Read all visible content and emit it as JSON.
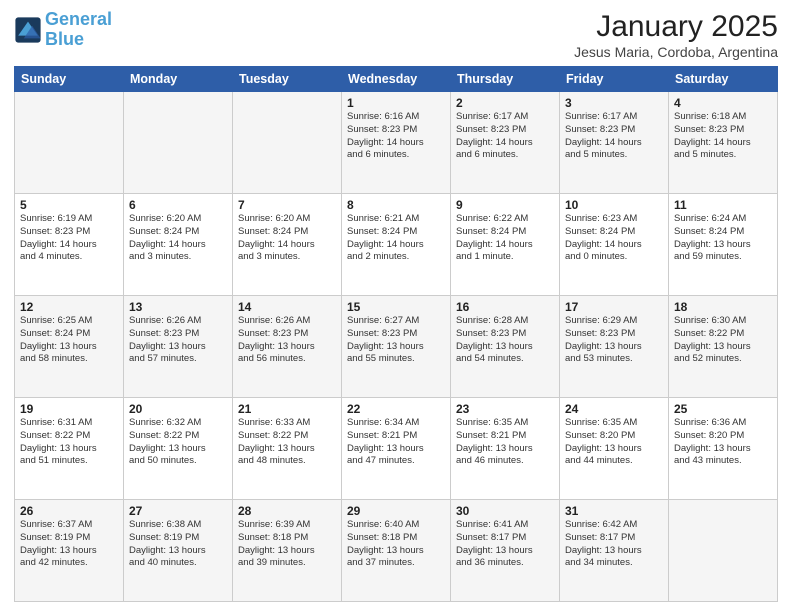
{
  "header": {
    "logo_line1": "General",
    "logo_line2": "Blue",
    "main_title": "January 2025",
    "subtitle": "Jesus Maria, Cordoba, Argentina"
  },
  "days_of_week": [
    "Sunday",
    "Monday",
    "Tuesday",
    "Wednesday",
    "Thursday",
    "Friday",
    "Saturday"
  ],
  "weeks": [
    [
      {
        "day": "",
        "info": ""
      },
      {
        "day": "",
        "info": ""
      },
      {
        "day": "",
        "info": ""
      },
      {
        "day": "1",
        "info": "Sunrise: 6:16 AM\nSunset: 8:23 PM\nDaylight: 14 hours\nand 6 minutes."
      },
      {
        "day": "2",
        "info": "Sunrise: 6:17 AM\nSunset: 8:23 PM\nDaylight: 14 hours\nand 6 minutes."
      },
      {
        "day": "3",
        "info": "Sunrise: 6:17 AM\nSunset: 8:23 PM\nDaylight: 14 hours\nand 5 minutes."
      },
      {
        "day": "4",
        "info": "Sunrise: 6:18 AM\nSunset: 8:23 PM\nDaylight: 14 hours\nand 5 minutes."
      }
    ],
    [
      {
        "day": "5",
        "info": "Sunrise: 6:19 AM\nSunset: 8:23 PM\nDaylight: 14 hours\nand 4 minutes."
      },
      {
        "day": "6",
        "info": "Sunrise: 6:20 AM\nSunset: 8:24 PM\nDaylight: 14 hours\nand 3 minutes."
      },
      {
        "day": "7",
        "info": "Sunrise: 6:20 AM\nSunset: 8:24 PM\nDaylight: 14 hours\nand 3 minutes."
      },
      {
        "day": "8",
        "info": "Sunrise: 6:21 AM\nSunset: 8:24 PM\nDaylight: 14 hours\nand 2 minutes."
      },
      {
        "day": "9",
        "info": "Sunrise: 6:22 AM\nSunset: 8:24 PM\nDaylight: 14 hours\nand 1 minute."
      },
      {
        "day": "10",
        "info": "Sunrise: 6:23 AM\nSunset: 8:24 PM\nDaylight: 14 hours\nand 0 minutes."
      },
      {
        "day": "11",
        "info": "Sunrise: 6:24 AM\nSunset: 8:24 PM\nDaylight: 13 hours\nand 59 minutes."
      }
    ],
    [
      {
        "day": "12",
        "info": "Sunrise: 6:25 AM\nSunset: 8:24 PM\nDaylight: 13 hours\nand 58 minutes."
      },
      {
        "day": "13",
        "info": "Sunrise: 6:26 AM\nSunset: 8:23 PM\nDaylight: 13 hours\nand 57 minutes."
      },
      {
        "day": "14",
        "info": "Sunrise: 6:26 AM\nSunset: 8:23 PM\nDaylight: 13 hours\nand 56 minutes."
      },
      {
        "day": "15",
        "info": "Sunrise: 6:27 AM\nSunset: 8:23 PM\nDaylight: 13 hours\nand 55 minutes."
      },
      {
        "day": "16",
        "info": "Sunrise: 6:28 AM\nSunset: 8:23 PM\nDaylight: 13 hours\nand 54 minutes."
      },
      {
        "day": "17",
        "info": "Sunrise: 6:29 AM\nSunset: 8:23 PM\nDaylight: 13 hours\nand 53 minutes."
      },
      {
        "day": "18",
        "info": "Sunrise: 6:30 AM\nSunset: 8:22 PM\nDaylight: 13 hours\nand 52 minutes."
      }
    ],
    [
      {
        "day": "19",
        "info": "Sunrise: 6:31 AM\nSunset: 8:22 PM\nDaylight: 13 hours\nand 51 minutes."
      },
      {
        "day": "20",
        "info": "Sunrise: 6:32 AM\nSunset: 8:22 PM\nDaylight: 13 hours\nand 50 minutes."
      },
      {
        "day": "21",
        "info": "Sunrise: 6:33 AM\nSunset: 8:22 PM\nDaylight: 13 hours\nand 48 minutes."
      },
      {
        "day": "22",
        "info": "Sunrise: 6:34 AM\nSunset: 8:21 PM\nDaylight: 13 hours\nand 47 minutes."
      },
      {
        "day": "23",
        "info": "Sunrise: 6:35 AM\nSunset: 8:21 PM\nDaylight: 13 hours\nand 46 minutes."
      },
      {
        "day": "24",
        "info": "Sunrise: 6:35 AM\nSunset: 8:20 PM\nDaylight: 13 hours\nand 44 minutes."
      },
      {
        "day": "25",
        "info": "Sunrise: 6:36 AM\nSunset: 8:20 PM\nDaylight: 13 hours\nand 43 minutes."
      }
    ],
    [
      {
        "day": "26",
        "info": "Sunrise: 6:37 AM\nSunset: 8:19 PM\nDaylight: 13 hours\nand 42 minutes."
      },
      {
        "day": "27",
        "info": "Sunrise: 6:38 AM\nSunset: 8:19 PM\nDaylight: 13 hours\nand 40 minutes."
      },
      {
        "day": "28",
        "info": "Sunrise: 6:39 AM\nSunset: 8:18 PM\nDaylight: 13 hours\nand 39 minutes."
      },
      {
        "day": "29",
        "info": "Sunrise: 6:40 AM\nSunset: 8:18 PM\nDaylight: 13 hours\nand 37 minutes."
      },
      {
        "day": "30",
        "info": "Sunrise: 6:41 AM\nSunset: 8:17 PM\nDaylight: 13 hours\nand 36 minutes."
      },
      {
        "day": "31",
        "info": "Sunrise: 6:42 AM\nSunset: 8:17 PM\nDaylight: 13 hours\nand 34 minutes."
      },
      {
        "day": "",
        "info": ""
      }
    ]
  ]
}
